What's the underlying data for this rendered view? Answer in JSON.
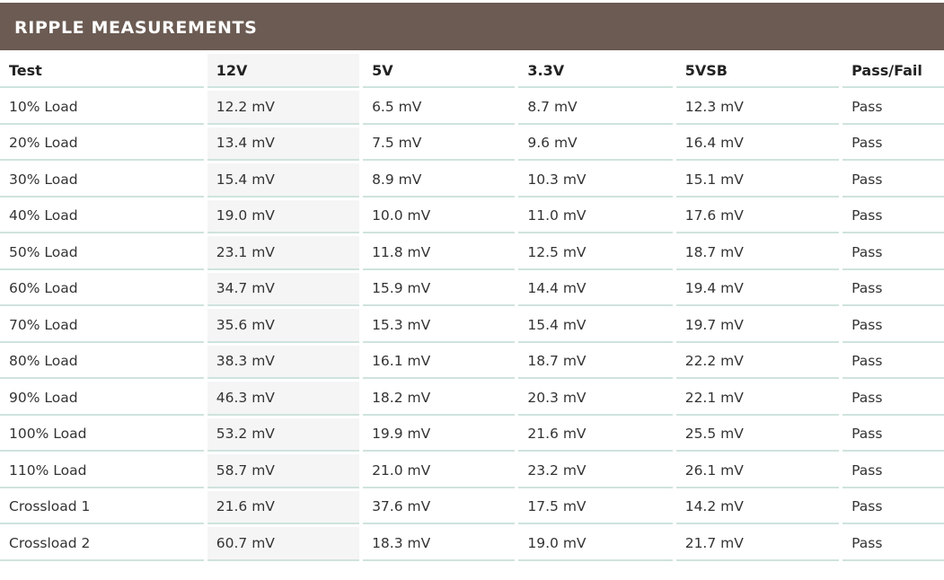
{
  "title": "RIPPLE MEASUREMENTS",
  "columns": [
    "Test",
    "12V",
    "5V",
    "3.3V",
    "5VSB",
    "Pass/Fail"
  ],
  "rows": [
    [
      "10% Load",
      "12.2 mV",
      "6.5 mV",
      "8.7 mV",
      "12.3 mV",
      "Pass"
    ],
    [
      "20% Load",
      "13.4 mV",
      "7.5 mV",
      "9.6 mV",
      "16.4 mV",
      "Pass"
    ],
    [
      "30% Load",
      "15.4 mV",
      "8.9 mV",
      "10.3 mV",
      "15.1 mV",
      "Pass"
    ],
    [
      "40% Load",
      "19.0 mV",
      "10.0 mV",
      "11.0 mV",
      "17.6 mV",
      "Pass"
    ],
    [
      "50% Load",
      "23.1 mV",
      "11.8 mV",
      "12.5 mV",
      "18.7 mV",
      "Pass"
    ],
    [
      "60% Load",
      "34.7 mV",
      "15.9 mV",
      "14.4 mV",
      "19.4 mV",
      "Pass"
    ],
    [
      "70% Load",
      "35.6 mV",
      "15.3 mV",
      "15.4 mV",
      "19.7 mV",
      "Pass"
    ],
    [
      "80% Load",
      "38.3 mV",
      "16.1 mV",
      "18.7 mV",
      "22.2 mV",
      "Pass"
    ],
    [
      "90% Load",
      "46.3 mV",
      "18.2 mV",
      "20.3 mV",
      "22.1 mV",
      "Pass"
    ],
    [
      "100% Load",
      "53.2 mV",
      "19.9 mV",
      "21.6 mV",
      "25.5 mV",
      "Pass"
    ],
    [
      "110% Load",
      "58.7 mV",
      "21.0 mV",
      "23.2 mV",
      "26.1 mV",
      "Pass"
    ],
    [
      "Crossload 1",
      "21.6 mV",
      "37.6 mV",
      "17.5 mV",
      "14.2 mV",
      "Pass"
    ],
    [
      "Crossload 2",
      "60.7 mV",
      "18.3 mV",
      "19.0 mV",
      "21.7 mV",
      "Pass"
    ]
  ],
  "colors": {
    "title_bar": "#6b5b53",
    "title_text": "#ffffff",
    "row_rule": "#cfe3de",
    "highlight_column": "#f5f5f5"
  }
}
